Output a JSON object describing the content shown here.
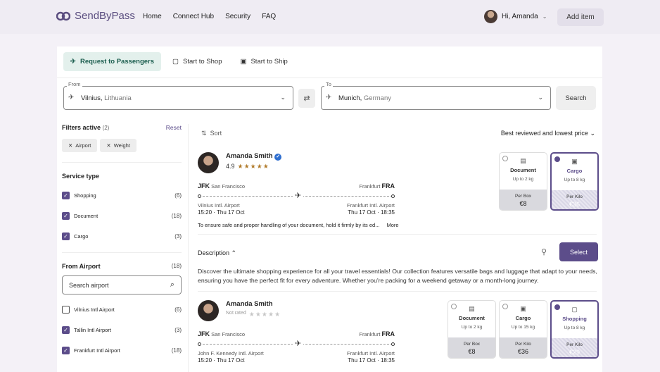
{
  "brand": {
    "name": "SendByPass"
  },
  "nav": [
    "Home",
    "Connect Hub",
    "Security",
    "FAQ"
  ],
  "user": {
    "greeting": "Hi, Amanda"
  },
  "header": {
    "add_item": "Add item"
  },
  "tabs": [
    "Request to Passengers",
    "Start to Shop",
    "Start to Ship"
  ],
  "search": {
    "from_label": "From",
    "from_city": "Vilnius,",
    "from_country": " Lithuania",
    "to_label": "To",
    "to_city": "Munich,",
    "to_country": " Germany",
    "button": "Search"
  },
  "filters": {
    "title": "Filters active",
    "count": "(2)",
    "reset": "Reset",
    "chips": [
      "Airport",
      "Weight"
    ]
  },
  "service": {
    "title": "Service type",
    "items": [
      {
        "label": "Shopping",
        "count": "(6)",
        "checked": true
      },
      {
        "label": "Document",
        "count": "(18)",
        "checked": true
      },
      {
        "label": "Cargo",
        "count": "(3)",
        "checked": true
      }
    ]
  },
  "from_airport": {
    "title": "From Airport",
    "count": "(18)",
    "placeholder": "Search airport",
    "items": [
      {
        "label": "Vilnius Intl Airport",
        "count": "(6)",
        "checked": false
      },
      {
        "label": "Tallin Intl Airport",
        "count": "(3)",
        "checked": true
      },
      {
        "label": "Frankfurt Intl Airport",
        "count": "(18)",
        "checked": true
      }
    ]
  },
  "sort": {
    "label": "Sort",
    "value": "Best reviewed and lowest price"
  },
  "listings": [
    {
      "name": "Amanda Smith",
      "rating": "4.9",
      "from_code": "JFK",
      "from_city": "San Francisco",
      "to_city": "Frankfurt",
      "to_code": "FRA",
      "from_airport": "Vilnius Intl. Airport",
      "to_airport": "Frankfurt Intl. Airport",
      "dep_time": "15:20",
      "dep_date": "Thu 17 Oct",
      "arr_date": "Thu 17 Oct",
      "arr_time": "18:35",
      "note": "To ensure safe and proper handling of your document, hold it firmly by its ed...",
      "more": "More",
      "options": [
        {
          "title": "Document",
          "sub": "Up to 2 kg",
          "label": "Per Box",
          "price": "€8",
          "selected": false
        },
        {
          "title": "Cargo",
          "sub": "Up to 8 kg",
          "label": "Per Kilo",
          "price": "€36",
          "selected": true
        }
      ]
    },
    {
      "name": "Amanda Smith",
      "rating": "Not rated",
      "from_code": "JFK",
      "from_city": "San Francisco",
      "to_city": "Frankfurt",
      "to_code": "FRA",
      "from_airport": "John F. Kennedy Intl. Airport",
      "to_airport": "Frankfurt Intl. Airport",
      "dep_time": "15:20",
      "dep_date": "Thu 17 Oct",
      "arr_date": "Thu 17 Oct",
      "arr_time": "18:35",
      "options": [
        {
          "title": "Document",
          "sub": "Up to 2 kg",
          "label": "Per Box",
          "price": "€8",
          "selected": false
        },
        {
          "title": "Cargo",
          "sub": "Up to 15 kg",
          "label": "Per Kilo",
          "price": "€36",
          "selected": false
        },
        {
          "title": "Shopping",
          "sub": "Up to 8 kg",
          "label": "Per Kilo",
          "price": "€29",
          "selected": true
        }
      ]
    }
  ],
  "description": {
    "title": "Description",
    "text": "Discover the ultimate shopping experience for all your travel essentials! Our collection features versatile bags and luggage that adapt to your needs, ensuring you have the perfect fit for every adventure. Whether you're packing for a weekend getaway or a month-long journey.",
    "select": "Select"
  }
}
